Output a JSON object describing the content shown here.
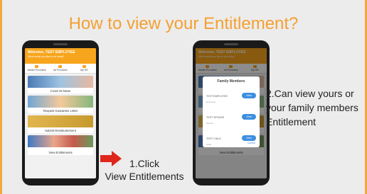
{
  "title": "How to view your Entitlement?",
  "colors": {
    "accent": "#f5a032",
    "app_header": "#f7a51c",
    "arrow": "#e0261c",
    "view_button": "#3d8fe0"
  },
  "phone1": {
    "welcome": "Welcome, TEST EMPLOYEE",
    "subtitle": "What would you like to do today?",
    "nav": [
      "Mobile Providers",
      "All Providers",
      "My HR"
    ],
    "cards": [
      {
        "label": "Covid-19 News",
        "image_icon": "covid-news-image"
      },
      {
        "label": "Request Guarantee Letter",
        "image_icon": "family-image"
      },
      {
        "label": "Submit Reimbursement",
        "image_icon": "receipt-image"
      },
      {
        "label": "View Entitlements",
        "image_icon": "people-image"
      }
    ]
  },
  "phone2": {
    "welcome": "Welcome, TEST EMPLOYEE",
    "subtitle": "What would you like to do today?",
    "nav": [
      "Mobile Providers",
      "All Providers",
      "My HR"
    ],
    "modal": {
      "title": "Family Members",
      "members": [
        {
          "name": "TEST EMPLOYEE",
          "relation": "Employee",
          "button": "View"
        },
        {
          "name": "TEST SPOUSE",
          "relation": "Spouse",
          "button": "View"
        },
        {
          "name": "TEST CHILD",
          "relation": "Child",
          "button": "View"
        }
      ],
      "cancel": "Cancel"
    },
    "bottom_card": "View Entitlements"
  },
  "steps": {
    "step1_line1": "1.Click",
    "step1_line2": "View Entitlements",
    "step2_line1": "2.Can view yours or",
    "step2_line2": "your family members",
    "step2_line3": "Entitlement"
  }
}
